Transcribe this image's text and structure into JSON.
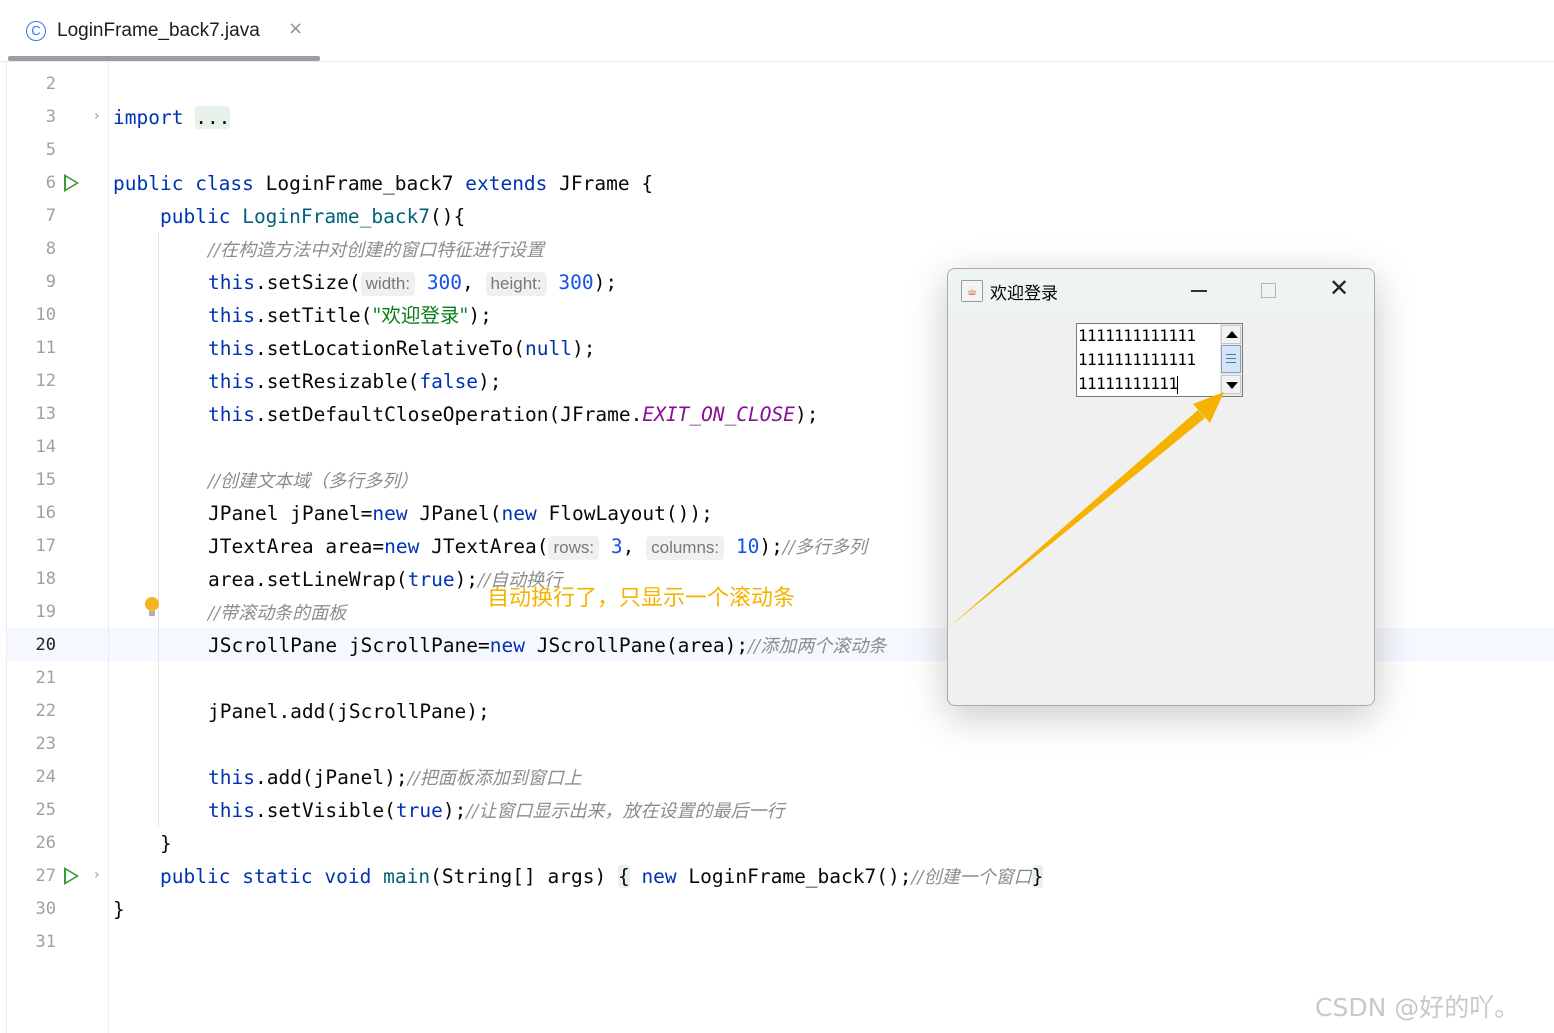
{
  "tab": {
    "icon": "class-icon",
    "icon_glyph": "C",
    "title": "LoginFrame_back7.java",
    "close": "×"
  },
  "lines": [
    {
      "n": "2"
    },
    {
      "n": "3"
    },
    {
      "n": "5"
    },
    {
      "n": "6"
    },
    {
      "n": "7"
    },
    {
      "n": "8"
    },
    {
      "n": "9"
    },
    {
      "n": "10"
    },
    {
      "n": "11"
    },
    {
      "n": "12"
    },
    {
      "n": "13"
    },
    {
      "n": "14"
    },
    {
      "n": "15"
    },
    {
      "n": "16"
    },
    {
      "n": "17"
    },
    {
      "n": "18"
    },
    {
      "n": "19"
    },
    {
      "n": "20"
    },
    {
      "n": "21"
    },
    {
      "n": "22"
    },
    {
      "n": "23"
    },
    {
      "n": "24"
    },
    {
      "n": "25"
    },
    {
      "n": "26"
    },
    {
      "n": "27"
    },
    {
      "n": "30"
    },
    {
      "n": "31"
    }
  ],
  "code": {
    "l3_kw": "import",
    "l3_fold": "...",
    "l6_kw1": "public",
    "l6_kw2": "class",
    "l6_name": " LoginFrame_back7 ",
    "l6_kw3": "extends",
    "l6_rest": " JFrame {",
    "l7_kw": "public",
    "l7_name": "LoginFrame_back7",
    "l7_rest": "(){",
    "l8_cmt": "//在构造方法中对创建的窗口特征进行设置",
    "l9_this": "this",
    "l9_a": ".setSize(",
    "l9_h1": "width:",
    "l9_n1": "300",
    "l9_comma": ",",
    "l9_h2": "height:",
    "l9_n2": "300",
    "l9_end": ");",
    "l10_this": "this",
    "l10_a": ".setTitle(",
    "l10_str": "\"欢迎登录\"",
    "l10_end": ");",
    "l11_this": "this",
    "l11_a": ".setLocationRelativeTo(",
    "l11_kw": "null",
    "l11_end": ");",
    "l12_this": "this",
    "l12_a": ".setResizable(",
    "l12_kw": "false",
    "l12_end": ");",
    "l13_this": "this",
    "l13_a": ".setDefaultCloseOperation(JFrame.",
    "l13_const": "EXIT_ON_CLOSE",
    "l13_end": ");",
    "l15_cmt": "//创建文本域（多行多列）",
    "l16_a": "JPanel jPanel=",
    "l16_kw1": "new",
    "l16_b": " JPanel(",
    "l16_kw2": "new",
    "l16_c": " FlowLayout());",
    "l17_a": "JTextArea area=",
    "l17_kw": "new",
    "l17_b": " JTextArea(",
    "l17_h1": "rows:",
    "l17_n1": "3",
    "l17_comma": ",",
    "l17_h2": "columns:",
    "l17_n2": "10",
    "l17_end": ");",
    "l17_cmt": "//多行多列",
    "l18_a": "area.setLineWrap(",
    "l18_kw": "true",
    "l18_end": ");",
    "l18_cmt": "//自动换行",
    "l19_cmt": "//带滚动条的面板",
    "l20_a": "JScrollPane jScrollPane=",
    "l20_kw": "new",
    "l20_b": " JScrollPane(area);",
    "l20_cmt": "//添加两个滚动条",
    "l22_a": "jPanel.add(jScrollPane);",
    "l24_this": "this",
    "l24_a": ".add(jPanel);",
    "l24_cmt": "//把面板添加到窗口上",
    "l25_this": "this",
    "l25_a": ".setVisible(",
    "l25_kw": "true",
    "l25_end": ");",
    "l25_cmt": "//让窗口显示出来，放在设置的最后一行",
    "l26": "}",
    "l27_kw1": "public",
    "l27_kw2": "static",
    "l27_kw3": "void",
    "l27_mth": "main",
    "l27_a": "(String[] args) ",
    "l27_ob": "{",
    "l27_kw4": "new",
    "l27_b": " LoginFrame_back7();",
    "l27_cmt": "//创建一个窗口",
    "l27_cb": "}",
    "l30": "}"
  },
  "window": {
    "title": "欢迎登录",
    "icon": "java-icon",
    "minimize": "minimize-icon",
    "maximize": "maximize-icon",
    "close_glyph": "✕",
    "textarea_lines": [
      "1111111111111",
      "1111111111111",
      "11111111111"
    ]
  },
  "annotation": {
    "text": "自动换行了，只显示一个滚动条",
    "color": "#f5b300"
  },
  "watermark": "CSDN @好的吖。",
  "colors": {
    "keyword": "#0033b3",
    "number": "#1750eb",
    "string": "#067d17",
    "comment": "#8c8c8c",
    "constant": "#871094",
    "run": "#3b9b3b"
  }
}
